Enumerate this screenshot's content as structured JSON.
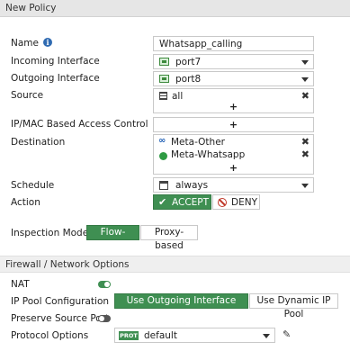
{
  "title": "New Policy",
  "name": {
    "label": "Name",
    "value": "Whatsapp_calling"
  },
  "incoming": {
    "label": "Incoming Interface",
    "value": "port7"
  },
  "outgoing": {
    "label": "Outgoing Interface",
    "value": "port8"
  },
  "source": {
    "label": "Source",
    "items": [
      "all"
    ],
    "add": "+"
  },
  "ipmac": {
    "label": "IP/MAC Based Access Control",
    "add": "+"
  },
  "destination": {
    "label": "Destination",
    "items": [
      "Meta-Other",
      "Meta-Whatsapp"
    ],
    "add": "+"
  },
  "schedule": {
    "label": "Schedule",
    "value": "always"
  },
  "action": {
    "label": "Action",
    "accept": "ACCEPT",
    "deny": "DENY",
    "selected": "ACCEPT"
  },
  "inspection": {
    "label": "Inspection Mode",
    "options": [
      "Flow-based",
      "Proxy-based"
    ],
    "selected": "Flow-based"
  },
  "firewall_section": {
    "title": "Firewall / Network Options"
  },
  "nat": {
    "label": "NAT",
    "enabled": true
  },
  "ip_pool": {
    "label": "IP Pool Configuration",
    "options": [
      "Use Outgoing Interface Address",
      "Use Dynamic IP Pool"
    ],
    "selected": "Use Outgoing Interface Address"
  },
  "preserve_port": {
    "label": "Preserve Source Port",
    "enabled": false
  },
  "protocol": {
    "label": "Protocol Options",
    "badge": "PROT",
    "value": "default"
  },
  "icons": {
    "info": "info-icon",
    "port": "interface-port-icon",
    "address": "address-object-icon",
    "meta": "meta-logo-icon",
    "whatsapp": "whatsapp-logo-icon",
    "schedule": "calendar-icon",
    "remove": "close-icon",
    "edit": "pencil-icon"
  },
  "colors": {
    "accent": "#3f8f52",
    "info": "#2f6ab1",
    "deny": "#c0392b"
  }
}
